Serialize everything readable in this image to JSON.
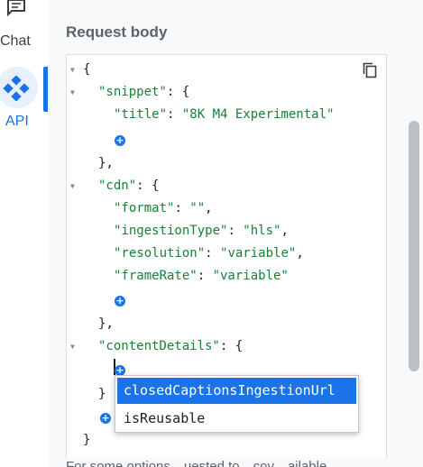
{
  "rail": {
    "chat_label": "Chat",
    "api_label": "API"
  },
  "main": {
    "section_title": "Request body",
    "footer_text": "For some options…uested to…cov…ailable…"
  },
  "editor": {
    "lines": {
      "l1": "{",
      "l2_key": "\"snippet\"",
      "l2_rest": ": {",
      "l3_key": "\"title\"",
      "l3_sep": ": ",
      "l3_val": "\"8K M4 Experimental\"",
      "l5": "},",
      "l6_key": "\"cdn\"",
      "l6_rest": ": {",
      "l7_key": "\"format\"",
      "l7_sep": ": ",
      "l7_val": "\"\"",
      "l7_end": ",",
      "l8_key": "\"ingestionType\"",
      "l8_sep": ": ",
      "l8_val": "\"hls\"",
      "l8_end": ",",
      "l9_key": "\"resolution\"",
      "l9_sep": ": ",
      "l9_val": "\"variable\"",
      "l9_end": ",",
      "l10_key": "\"frameRate\"",
      "l10_sep": ": ",
      "l10_val": "\"variable\"",
      "l12": "},",
      "l13_key": "\"contentDetails\"",
      "l13_rest": ": {",
      "l15": "}",
      "l17": "}"
    },
    "add_symbol": "+"
  },
  "autocomplete": {
    "options": [
      "closedCaptionsIngestionUrl",
      "isReusable"
    ]
  },
  "colors": {
    "accent": "#1a73e8",
    "json_key": "#188038"
  },
  "icons": {
    "chat": "chat-bubble-icon",
    "api": "api-diamond-icon",
    "copy": "copy-icon",
    "add": "add-circle-icon"
  }
}
